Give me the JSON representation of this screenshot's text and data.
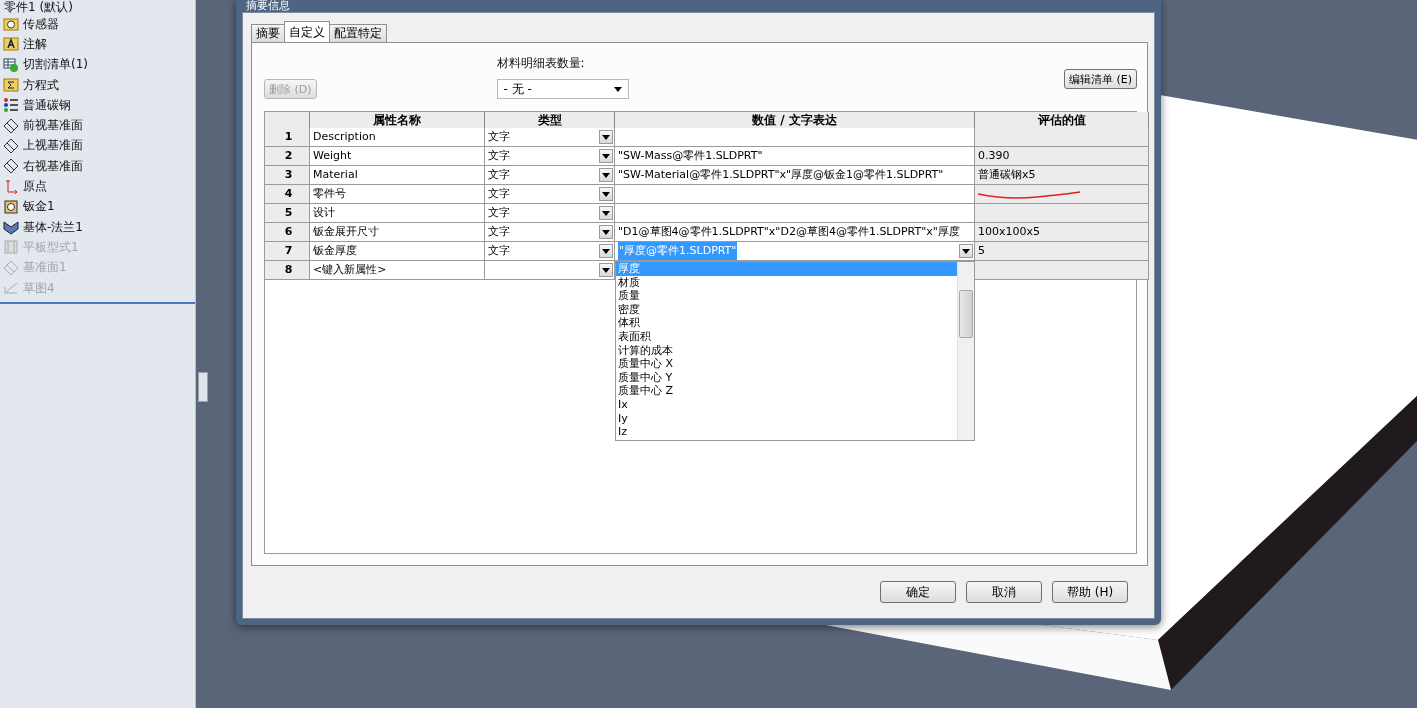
{
  "feature_tree": {
    "root": "零件1 (默认)",
    "items": [
      {
        "label": "传感器",
        "kind": "sensor",
        "disabled": false
      },
      {
        "label": "注解",
        "kind": "annotation",
        "disabled": false
      },
      {
        "label": "切割清单(1)",
        "kind": "cutlist",
        "disabled": false
      },
      {
        "label": "方程式",
        "kind": "equation",
        "disabled": false
      },
      {
        "label": "普通碳钢",
        "kind": "material",
        "disabled": false
      },
      {
        "label": "前视基准面",
        "kind": "plane",
        "disabled": false
      },
      {
        "label": "上视基准面",
        "kind": "plane",
        "disabled": false
      },
      {
        "label": "右视基准面",
        "kind": "plane",
        "disabled": false
      },
      {
        "label": "原点",
        "kind": "origin",
        "disabled": false
      },
      {
        "label": "钣金1",
        "kind": "sheetmetal",
        "disabled": false
      },
      {
        "label": "基体-法兰1",
        "kind": "flange",
        "disabled": false
      },
      {
        "label": "平板型式1",
        "kind": "flat",
        "disabled": true
      },
      {
        "label": "基准面1",
        "kind": "plane",
        "disabled": true
      },
      {
        "label": "草图4",
        "kind": "sketch",
        "disabled": true
      }
    ]
  },
  "dialog": {
    "title": "摘要信息",
    "tabs": [
      {
        "label": "摘要",
        "selected": false
      },
      {
        "label": "自定义",
        "selected": true
      },
      {
        "label": "配置特定",
        "selected": false
      }
    ],
    "delete_button": {
      "label": "删除 (D)",
      "disabled": true
    },
    "bom_quantity": {
      "label": "材料明细表数量:",
      "value": "- 无 -"
    },
    "edit_list_button": "编辑清单 (E)",
    "table": {
      "columns": [
        "属性名称",
        "类型",
        "数值 / 文字表达",
        "评估的值"
      ],
      "rows": [
        {
          "number": "1",
          "name": "Description",
          "type": "文字",
          "value": "",
          "evaluated": "",
          "editing": false,
          "marked": false
        },
        {
          "number": "2",
          "name": "Weight",
          "type": "文字",
          "value": "\"SW-Mass@零件1.SLDPRT\"",
          "evaluated": "0.390",
          "editing": false,
          "marked": false
        },
        {
          "number": "3",
          "name": "Material",
          "type": "文字",
          "value": "\"SW-Material@零件1.SLDPRT\"x\"厚度@钣金1@零件1.SLDPRT\"",
          "evaluated": "普通碳钢x5",
          "editing": false,
          "marked": false
        },
        {
          "number": "4",
          "name": "零件号",
          "type": "文字",
          "value": "",
          "evaluated": "",
          "editing": false,
          "marked": true
        },
        {
          "number": "5",
          "name": "设计",
          "type": "文字",
          "value": "",
          "evaluated": "",
          "editing": false,
          "marked": false
        },
        {
          "number": "6",
          "name": "钣金展开尺寸",
          "type": "文字",
          "value": "\"D1@草图4@零件1.SLDPRT\"x\"D2@草图4@零件1.SLDPRT\"x\"厚度",
          "evaluated": "100x100x5",
          "editing": false,
          "marked": false
        },
        {
          "number": "7",
          "name": "钣金厚度",
          "type": "文字",
          "value": "\"厚度@零件1.SLDPRT\"",
          "evaluated": "5",
          "editing": true,
          "marked": false
        },
        {
          "number": "8",
          "name": "<键入新属性>",
          "type": "",
          "value": "",
          "evaluated": "",
          "editing": false,
          "marked": false
        }
      ]
    },
    "value_dropdown": [
      {
        "label": "厚度",
        "selected": true
      },
      {
        "label": "材质",
        "selected": false
      },
      {
        "label": "质量",
        "selected": false
      },
      {
        "label": "密度",
        "selected": false
      },
      {
        "label": "体积",
        "selected": false
      },
      {
        "label": "表面积",
        "selected": false
      },
      {
        "label": "计算的成本",
        "selected": false
      },
      {
        "label": "质量中心 X",
        "selected": false
      },
      {
        "label": "质量中心 Y",
        "selected": false
      },
      {
        "label": "质量中心 Z",
        "selected": false
      },
      {
        "label": "Ix",
        "selected": false
      },
      {
        "label": "Iy",
        "selected": false
      },
      {
        "label": "Iz",
        "selected": false
      }
    ],
    "buttons": [
      "确定",
      "取消",
      "帮助 (H)"
    ]
  }
}
